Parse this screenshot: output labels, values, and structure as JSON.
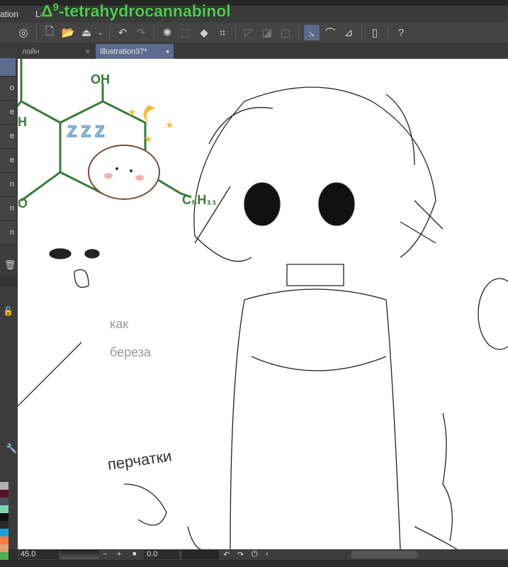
{
  "menu": {
    "item1": "ation",
    "item2": "La"
  },
  "overlay_title": {
    "prefix": "Δ",
    "sup": "9",
    "text": "-tetrahydrocannabinol"
  },
  "tabs": [
    {
      "label": "лайн",
      "close": "×"
    },
    {
      "label": "Illustration37*",
      "dot": "●"
    }
  ],
  "left_panel": {
    "labels": [
      "o",
      "e",
      "e",
      "e",
      "n",
      "n",
      "n"
    ]
  },
  "molecule": {
    "oh": "OH",
    "h": "H",
    "o": "O",
    "c5": "C₅H₁₁"
  },
  "sticker": {
    "zzz": "Z Z Z"
  },
  "sketch": {
    "note1": "как",
    "note2": "береза",
    "note3": "перчатки"
  },
  "statusbar": {
    "zoom": "45.0",
    "minus": "−",
    "plus": "+",
    "angle": "0.0"
  },
  "colors": {
    "accent": "#5c6b8e",
    "molecule": "#3a7a3a",
    "title": "#5cc05c"
  },
  "palette": [
    "#b0b0b0",
    "#5a1020",
    "#4a5060",
    "#7fd6b0",
    "#111111",
    "#2a2a2a",
    "#1ea0e0",
    "#ff7a40",
    "#e0a070",
    "#4caf50"
  ]
}
